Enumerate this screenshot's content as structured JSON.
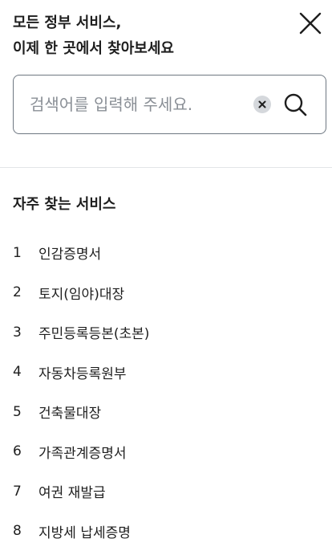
{
  "header": {
    "title_line1": "모든 정부 서비스,",
    "title_line2": "이제 한 곳에서 찾아보세요",
    "close_icon": "close-icon"
  },
  "search": {
    "value": "",
    "placeholder": "검색어를 입력해 주세요.",
    "clear_icon": "clear-circle-icon",
    "search_icon": "search-icon"
  },
  "popular": {
    "title": "자주 찾는 서비스",
    "items": [
      {
        "rank": "1",
        "label": "인감증명서"
      },
      {
        "rank": "2",
        "label": "토지(임야)대장"
      },
      {
        "rank": "3",
        "label": "주민등록등본(초본)"
      },
      {
        "rank": "4",
        "label": "자동차등록원부"
      },
      {
        "rank": "5",
        "label": "건축물대장"
      },
      {
        "rank": "6",
        "label": "가족관계증명서"
      },
      {
        "rank": "7",
        "label": "여권 재발급"
      },
      {
        "rank": "8",
        "label": "지방세 납세증명"
      }
    ]
  },
  "colors": {
    "text": "#1e1e1e",
    "placeholder": "#8a8f96",
    "border": "#6e7781",
    "divider": "#e2e5e8",
    "clear_bg": "#d5d8dc"
  }
}
